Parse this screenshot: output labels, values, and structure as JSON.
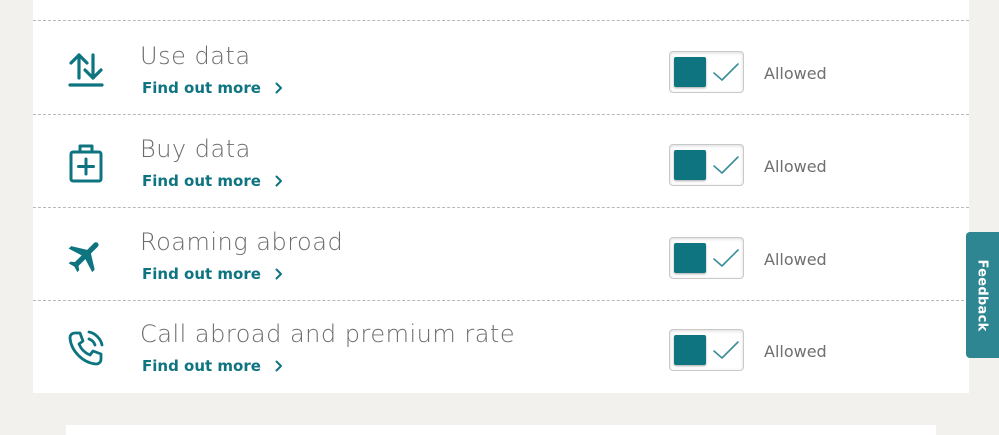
{
  "rows": [
    {
      "id": "use-data",
      "title": "Use data",
      "link": "Find out more",
      "icon": "up-down-arrows-icon",
      "toggle_on": true,
      "status": "Allowed"
    },
    {
      "id": "buy-data",
      "title": "Buy data",
      "link": "Find out more",
      "icon": "shopping-bag-plus-icon",
      "toggle_on": true,
      "status": "Allowed"
    },
    {
      "id": "roaming",
      "title": "Roaming abroad",
      "link": "Find out more",
      "icon": "airplane-icon",
      "toggle_on": true,
      "status": "Allowed"
    },
    {
      "id": "call-abroad",
      "title": "Call abroad and premium rate",
      "link": "Find out more",
      "icon": "phone-call-icon",
      "toggle_on": true,
      "status": "Allowed"
    }
  ],
  "feedback": {
    "label": "Feedback"
  },
  "colors": {
    "accent": "#0d7480",
    "feedback_bg": "#2e8692",
    "page_bg": "#f3f1ed",
    "title_text": "#6b6b6b"
  }
}
